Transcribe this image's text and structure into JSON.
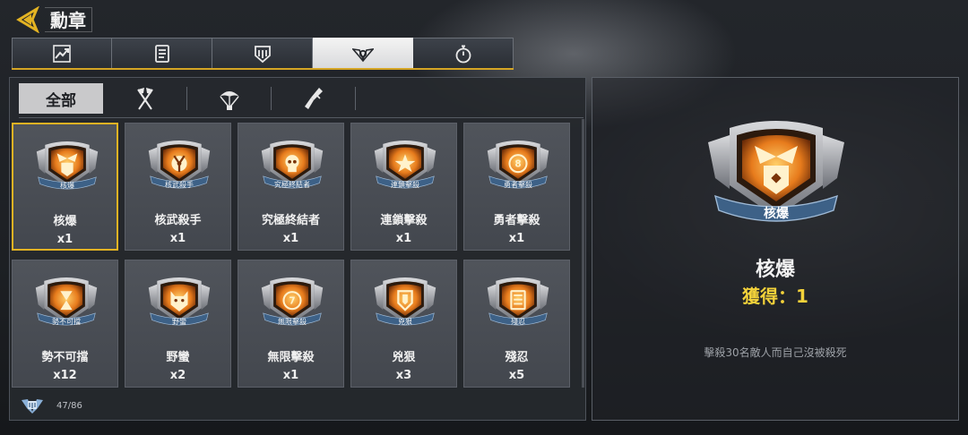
{
  "header": {
    "title": "勳章",
    "back_icon": "back-arrow-icon"
  },
  "category_tabs": [
    {
      "icon": "stats-chart-icon",
      "active": false
    },
    {
      "icon": "clipboard-icon",
      "active": false
    },
    {
      "icon": "emblem-shield-icon",
      "active": false
    },
    {
      "icon": "medal-wings-icon",
      "active": true
    },
    {
      "icon": "stopwatch-icon",
      "active": false
    }
  ],
  "filters": {
    "all_label": "全部",
    "icons": [
      "crossed-flags-icon",
      "parachute-icon",
      "weapon-icon"
    ]
  },
  "medals": [
    {
      "badge_label": "核爆",
      "name": "核爆",
      "count": "x1",
      "symbol": "nuke"
    },
    {
      "badge_label": "核武殺手",
      "name": "核武殺手",
      "count": "x1",
      "symbol": "radiation"
    },
    {
      "badge_label": "究極終結者",
      "name": "究極終結者",
      "count": "x1",
      "symbol": "skull"
    },
    {
      "badge_label": "連鎖擊殺",
      "name": "連鎖擊殺",
      "count": "x1",
      "symbol": "star"
    },
    {
      "badge_label": "勇者擊殺",
      "name": "勇者擊殺",
      "count": "x1",
      "symbol": "eight"
    },
    {
      "badge_label": "勢不可擋",
      "name": "勢不可擋",
      "count": "x12",
      "symbol": "hourglass"
    },
    {
      "badge_label": "野蠻",
      "name": "野蠻",
      "count": "x2",
      "symbol": "beast"
    },
    {
      "badge_label": "無限擊殺",
      "name": "無限擊殺",
      "count": "x1",
      "symbol": "seven"
    },
    {
      "badge_label": "兇狠",
      "name": "兇狠",
      "count": "x3",
      "symbol": "shield"
    },
    {
      "badge_label": "殘忍",
      "name": "殘忍",
      "count": "x5",
      "symbol": "bars"
    }
  ],
  "footer": {
    "icon": "medal-collection-icon",
    "progress": "47/86"
  },
  "detail": {
    "badge_label": "核爆",
    "name": "核爆",
    "obtained": "獲得：1",
    "description": "擊殺30名敵人而自己沒被殺死"
  },
  "colors": {
    "accent_gold": "#e3b323",
    "obtained_yellow": "#f3d23a",
    "badge_orange": "#f0a030"
  }
}
